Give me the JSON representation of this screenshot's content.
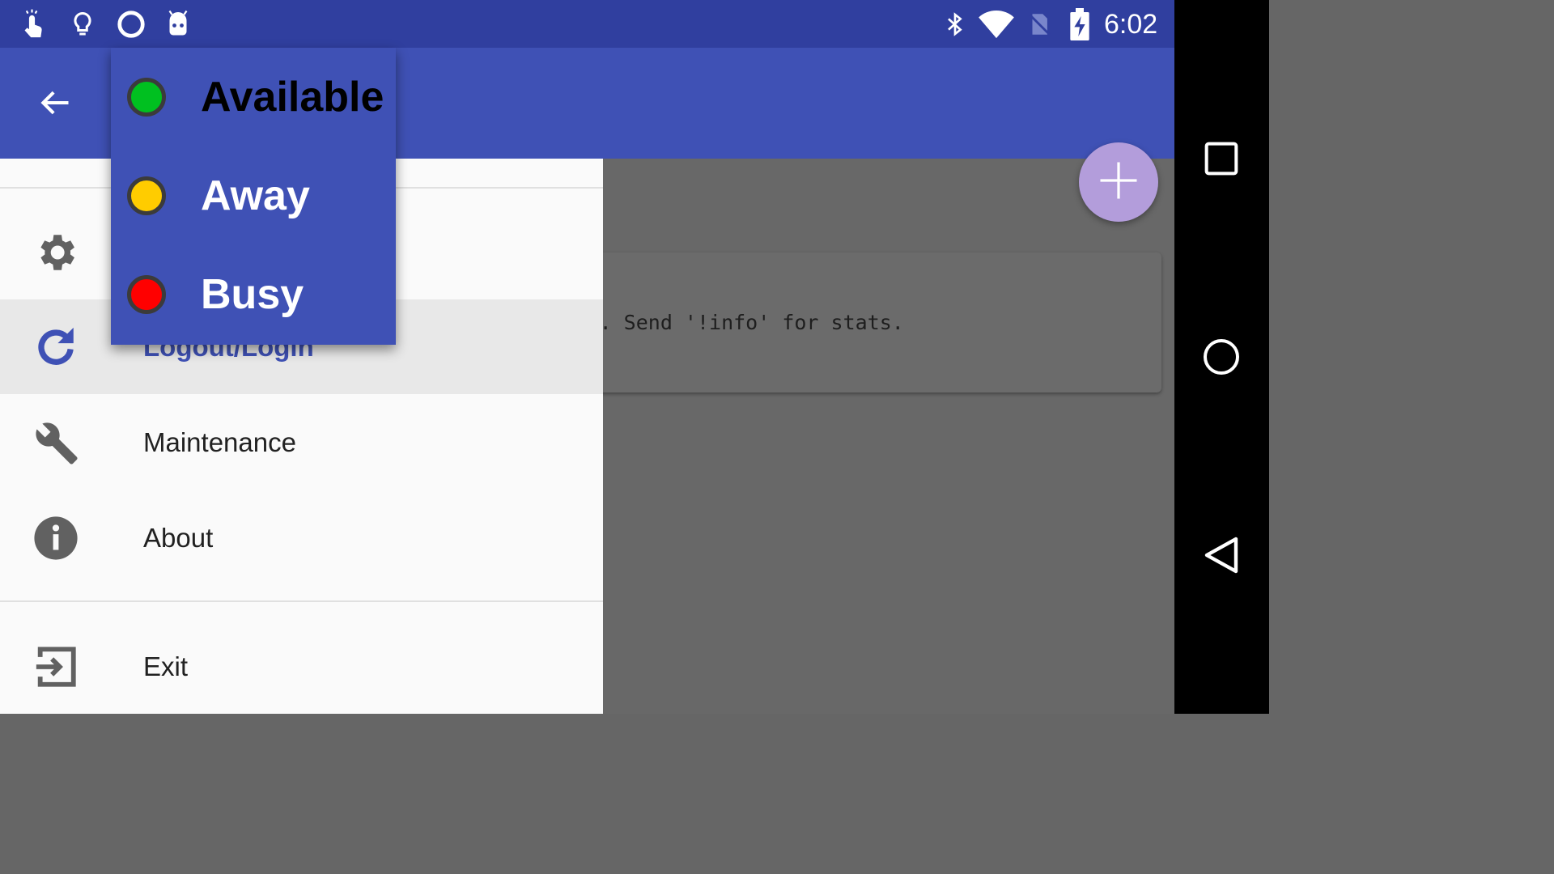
{
  "status_bar": {
    "time": "6:02",
    "left_icons": [
      "touch-hand-icon",
      "lightbulb-icon",
      "circle-icon",
      "android-robot-icon"
    ],
    "right_icons": [
      "bluetooth-icon",
      "wifi-icon",
      "no-sim-icon",
      "battery-charging-icon"
    ]
  },
  "app_bar": {
    "back_icon": "arrow-back-icon",
    "color": "#3F51B5"
  },
  "status_popup": {
    "items": [
      {
        "label": "Available",
        "color": "#00C020"
      },
      {
        "label": "Away",
        "color": "#FFCC00"
      },
      {
        "label": "Busy",
        "color": "#FF0000"
      }
    ]
  },
  "drawer": {
    "items": [
      {
        "icon": "gear-icon",
        "label": ""
      },
      {
        "icon": "refresh-icon",
        "label": "Logout/Login"
      },
      {
        "icon": "wrench-icon",
        "label": "Maintenance"
      },
      {
        "icon": "info-icon",
        "label": "About"
      },
      {
        "icon": "exit-icon",
        "label": "Exit"
      }
    ]
  },
  "main": {
    "message_text": "Bot service. Send '!info' for stats.",
    "fab_icon": "plus-icon"
  },
  "nav_bar": {
    "icons": [
      "recents-square-icon",
      "home-circle-icon",
      "back-triangle-icon"
    ]
  },
  "colors": {
    "status_bar": "#303F9F",
    "accent": "#B39DDB",
    "drawer_bg": "#FAFAFA"
  }
}
